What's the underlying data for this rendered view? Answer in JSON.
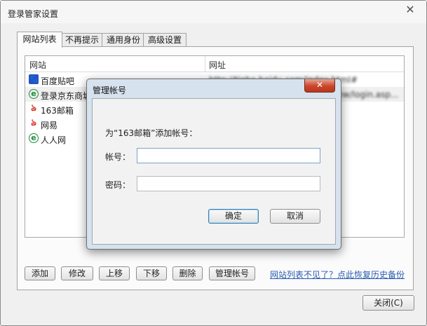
{
  "window": {
    "title": "登录管家设置",
    "close_glyph": "✕"
  },
  "tabs": [
    {
      "label": "网站列表",
      "active": true
    },
    {
      "label": "不再提示"
    },
    {
      "label": "通用身份"
    },
    {
      "label": "高级设置"
    }
  ],
  "list": {
    "columns": [
      "网站",
      "网址"
    ],
    "rows": [
      {
        "name": "百度贴吧",
        "icon": "paw-icon",
        "url": "http://tieba.baidu.com/index.html#"
      },
      {
        "name": "登录京东商城",
        "icon": "ie-icon",
        "url": "https://passport.360buy.com/new/login.asp..."
      },
      {
        "name": "163邮箱",
        "icon": "netease-icon",
        "url": ""
      },
      {
        "name": "网易",
        "icon": "netease-icon",
        "url": ""
      },
      {
        "name": "人人网",
        "icon": "ie-icon",
        "url": ""
      }
    ]
  },
  "buttons": {
    "add": "添加",
    "edit": "修改",
    "move_up": "上移",
    "move_down": "下移",
    "delete": "删除",
    "manage": "管理帐号",
    "restore_link": "网站列表不见了？点此恢复历史备份",
    "close": "关闭(C)"
  },
  "dialog": {
    "title": "管理帐号",
    "close_glyph": "✕",
    "prompt": "为“163邮箱”添加帐号：",
    "account_label": "帐号：",
    "account_value": "",
    "password_label": "密码：",
    "password_value": "",
    "ok": "确定",
    "cancel": "取消"
  }
}
